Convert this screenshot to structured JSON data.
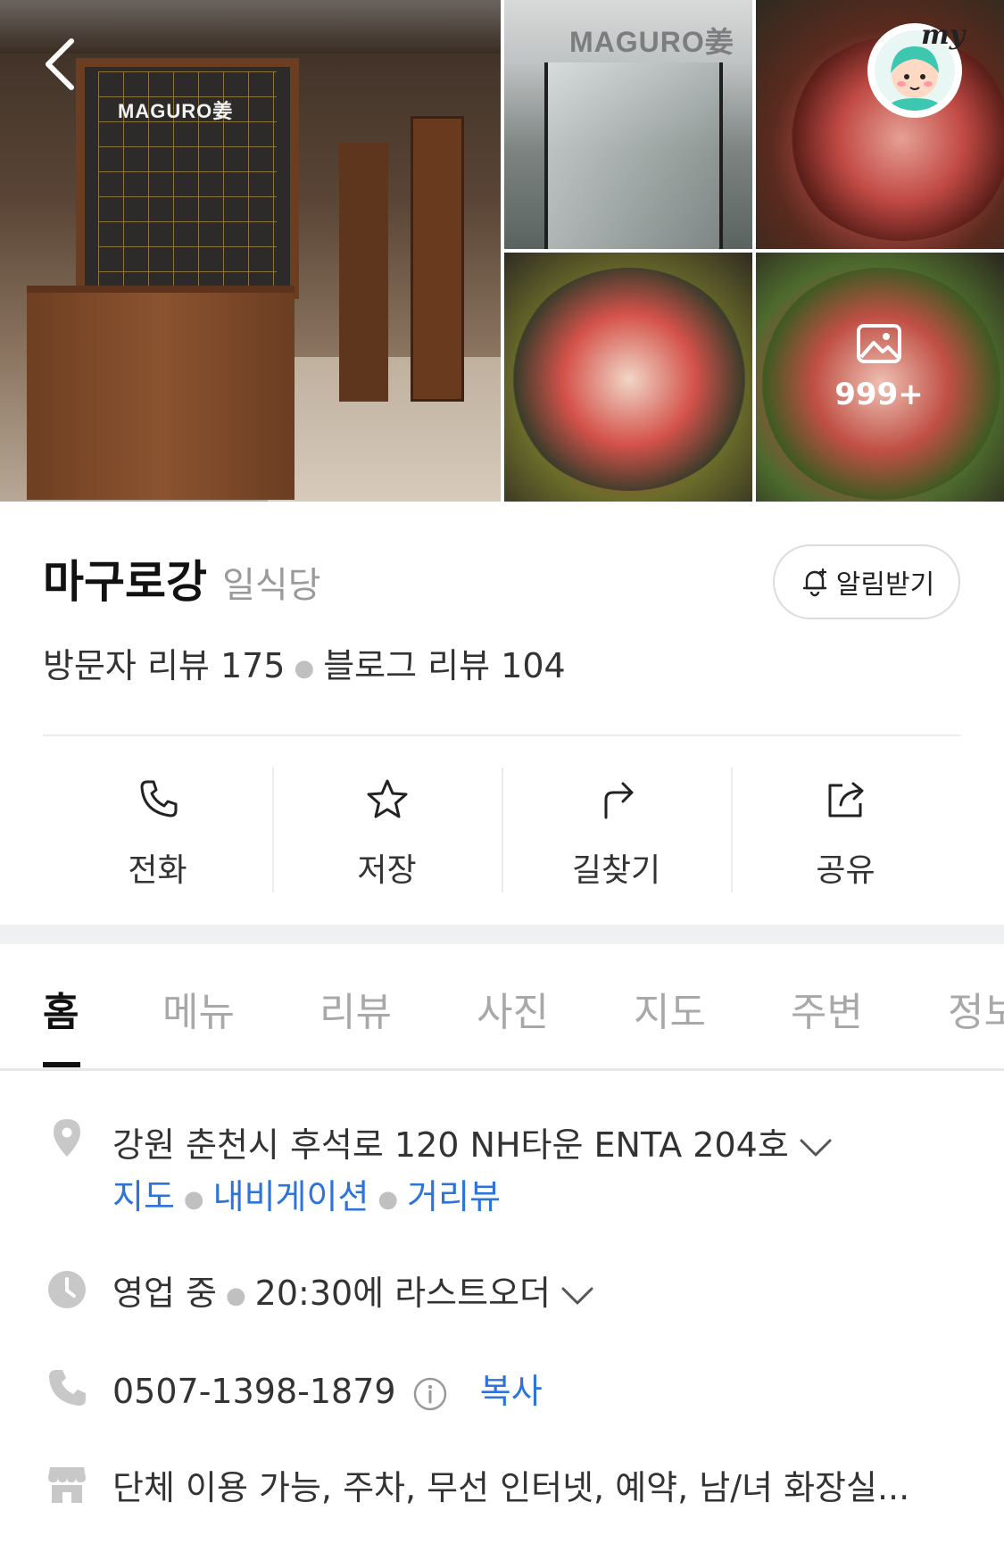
{
  "gallery": {
    "main_sign": "MAGURO姜",
    "entrance_sign": "MAGURO姜",
    "more_count": "999+"
  },
  "profile": {
    "my_label": "my"
  },
  "place": {
    "name": "마구로강",
    "category": "일식당",
    "alert_label": "알림받기",
    "visitor_reviews": "방문자 리뷰 175",
    "blog_reviews": "블로그 리뷰 104"
  },
  "actions": [
    {
      "label": "전화",
      "icon": "phone-icon"
    },
    {
      "label": "저장",
      "icon": "star-icon"
    },
    {
      "label": "길찾기",
      "icon": "directions-icon"
    },
    {
      "label": "공유",
      "icon": "share-icon"
    }
  ],
  "tabs": [
    "홈",
    "메뉴",
    "리뷰",
    "사진",
    "지도",
    "주변",
    "정보"
  ],
  "info": {
    "address": "강원 춘천시 후석로 120 NH타운 ENTA 204호",
    "address_links": [
      "지도",
      "내비게이션",
      "거리뷰"
    ],
    "status": "영업 중",
    "hours_note": "20:30에 라스트오더",
    "phone": "0507-1398-1879",
    "copy_label": "복사",
    "amenities": "단체 이용 가능, 주차, 무선 인터넷, 예약, 남/녀 화장실..."
  },
  "colors": {
    "link": "#2d73d9",
    "map_pin": "#c8c8c8"
  }
}
